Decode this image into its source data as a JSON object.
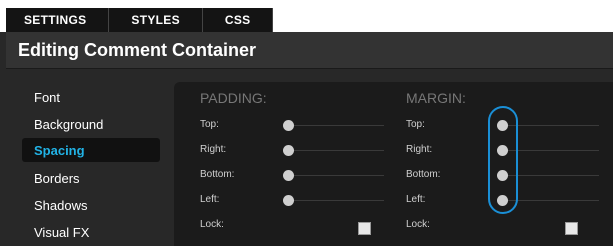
{
  "tabs": [
    {
      "label": "SETTINGS"
    },
    {
      "label": "STYLES"
    },
    {
      "label": "CSS"
    }
  ],
  "title": "Editing Comment Container",
  "sidebar": {
    "items": [
      {
        "label": "Font"
      },
      {
        "label": "Background"
      },
      {
        "label": "Spacing",
        "active": true
      },
      {
        "label": "Borders"
      },
      {
        "label": "Shadows"
      },
      {
        "label": "Visual FX"
      }
    ]
  },
  "padding": {
    "title": "PADDING:",
    "rows": [
      {
        "label": "Top:"
      },
      {
        "label": "Right:"
      },
      {
        "label": "Bottom:"
      },
      {
        "label": "Left:"
      }
    ],
    "lock_label": "Lock:"
  },
  "margin": {
    "title": "MARGIN:",
    "rows": [
      {
        "label": "Top:"
      },
      {
        "label": "Right:"
      },
      {
        "label": "Bottom:"
      },
      {
        "label": "Left:"
      }
    ],
    "lock_label": "Lock:"
  },
  "colors": {
    "accent": "#22b3e6",
    "highlight": "#1a8fd6"
  }
}
